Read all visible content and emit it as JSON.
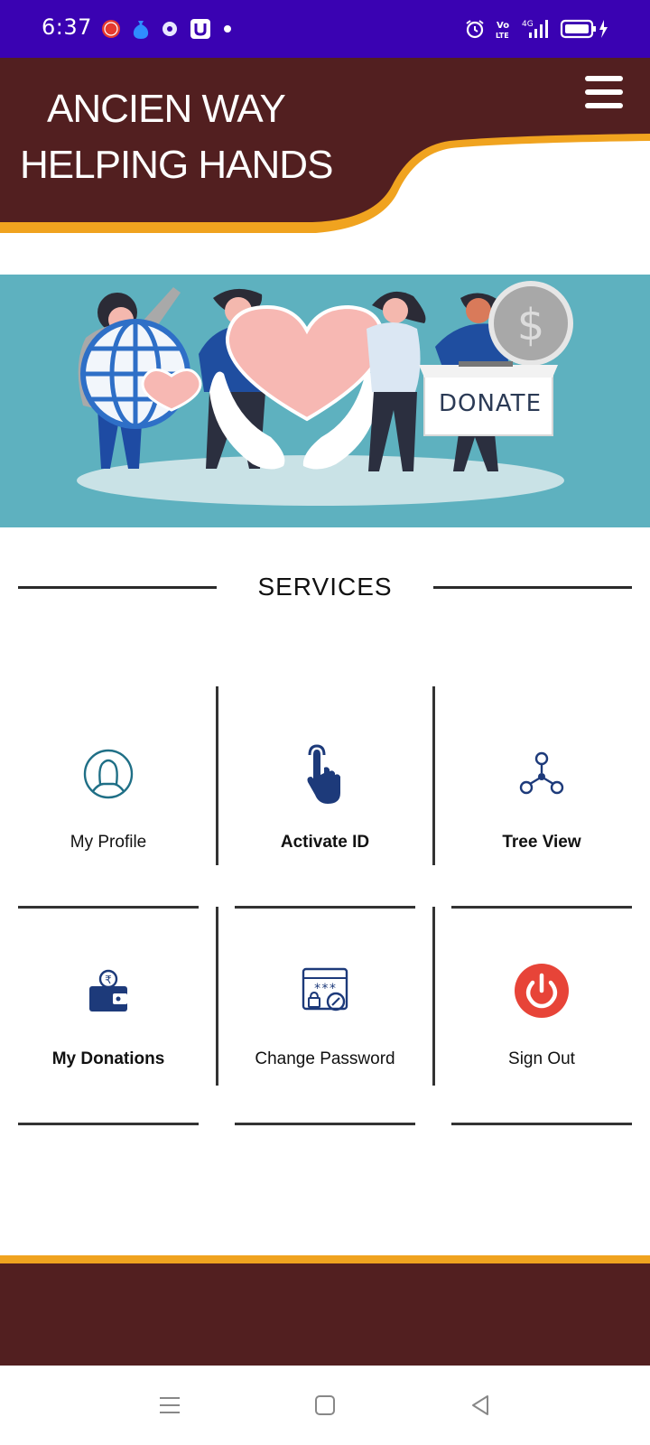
{
  "status_bar": {
    "time": "6:37",
    "left_icons": [
      "lenskart-icon",
      "money-bag-icon",
      "hotstar-icon",
      "u-app-icon",
      "dot-icon"
    ],
    "right_icons": [
      "alarm-icon",
      "volte-icon",
      "signal-4g-icon",
      "battery-charging-icon"
    ],
    "network": "4G",
    "volte": "Vo LTE"
  },
  "header": {
    "title_line1": "ANCIEN WAY",
    "title_line2": "HELPING HANDS",
    "menu_icon": "hamburger-menu-icon",
    "colors": {
      "primary": "#521f20",
      "accent": "#f0a31f"
    }
  },
  "banner": {
    "illustration": "donation-hands-illustration",
    "donate_text": "DONATE"
  },
  "services": {
    "title": "SERVICES",
    "items": [
      {
        "label": "My Profile",
        "icon": "user-profile-icon"
      },
      {
        "label": "Activate ID",
        "icon": "tap-hand-icon"
      },
      {
        "label": "Tree View",
        "icon": "tree-network-icon"
      },
      {
        "label": "My Donations",
        "icon": "wallet-rupee-icon"
      },
      {
        "label": "Change Password",
        "icon": "password-lock-icon"
      },
      {
        "label": "Sign Out",
        "icon": "power-icon"
      }
    ]
  },
  "navigation_bar": {
    "buttons": [
      "recent-apps-icon",
      "home-icon",
      "back-icon"
    ]
  }
}
